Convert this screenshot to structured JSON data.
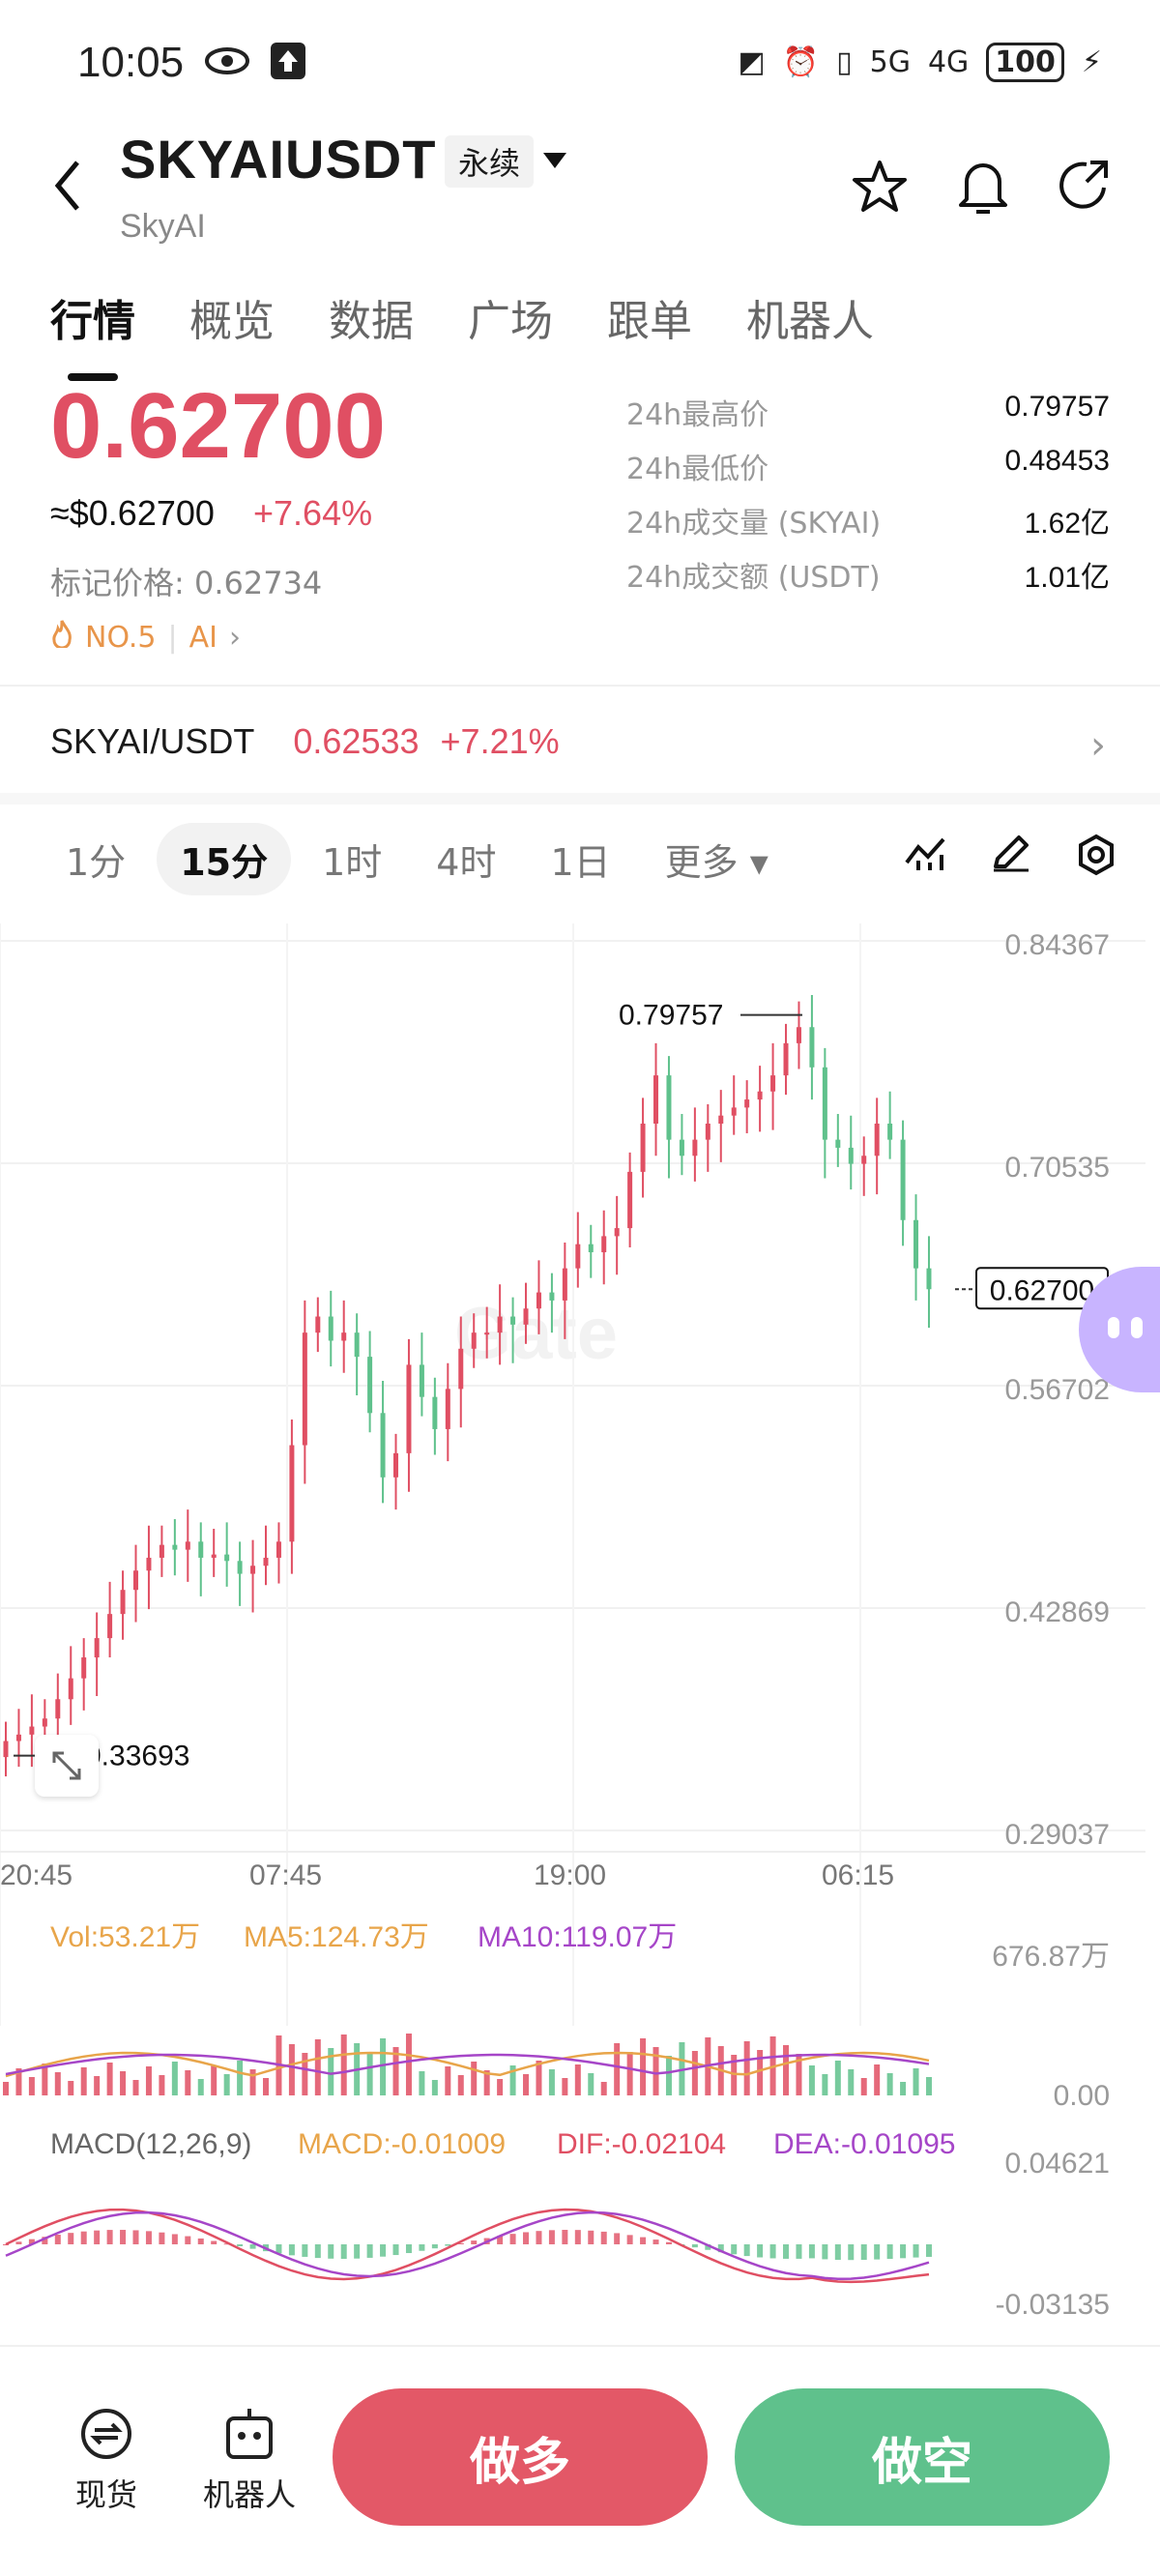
{
  "status": {
    "time": "10:05",
    "network1": "5G",
    "network2": "4G",
    "battery": "100"
  },
  "header": {
    "symbol": "SKYAIUSDT",
    "contract_type": "永续",
    "name": "SkyAI"
  },
  "tabs": [
    "行情",
    "概览",
    "数据",
    "广场",
    "跟单",
    "机器人"
  ],
  "price": {
    "last": "0.62700",
    "usd": "≈$0.62700",
    "change": "+7.64%",
    "mark_label": "标记价格: 0.62734",
    "rank": "NO.5",
    "category": "AI"
  },
  "stats": [
    {
      "label": "24h最高价",
      "value": "0.79757"
    },
    {
      "label": "24h最低价",
      "value": "0.48453"
    },
    {
      "label": "24h成交量 (SKYAI)",
      "value": "1.62亿"
    },
    {
      "label": "24h成交额 (USDT)",
      "value": "1.01亿"
    }
  ],
  "spot": {
    "pair": "SKYAI/USDT",
    "price": "0.62533",
    "change": "+7.21%"
  },
  "timeframes": [
    "1分",
    "15分",
    "1时",
    "4时",
    "1日",
    "更多"
  ],
  "timeframe_selected": "15分",
  "chart_data": {
    "type": "candlestick",
    "y_ticks": [
      "0.84367",
      "0.70535",
      "0.56702",
      "0.42869",
      "0.29037"
    ],
    "ylim": [
      0.29037,
      0.84367
    ],
    "x_ticks": [
      "20:45",
      "07:45",
      "19:00",
      "06:15"
    ],
    "high_label": "0.79757",
    "low_label": "0.33693",
    "last_label": "0.62700",
    "watermark": "Gate",
    "closes": [
      0.346,
      0.35,
      0.355,
      0.36,
      0.372,
      0.385,
      0.398,
      0.41,
      0.425,
      0.44,
      0.452,
      0.46,
      0.468,
      0.465,
      0.47,
      0.46,
      0.462,
      0.458,
      0.45,
      0.455,
      0.46,
      0.47,
      0.53,
      0.6,
      0.61,
      0.595,
      0.6,
      0.585,
      0.55,
      0.51,
      0.525,
      0.58,
      0.56,
      0.54,
      0.565,
      0.59,
      0.6,
      0.6,
      0.61,
      0.605,
      0.615,
      0.625,
      0.62,
      0.64,
      0.655,
      0.65,
      0.66,
      0.665,
      0.7,
      0.73,
      0.76,
      0.72,
      0.71,
      0.72,
      0.73,
      0.735,
      0.74,
      0.745,
      0.75,
      0.76,
      0.78,
      0.79,
      0.765,
      0.72,
      0.715,
      0.705,
      0.71,
      0.73,
      0.72,
      0.67,
      0.64,
      0.627
    ],
    "volume": {
      "vol": "Vol:53.21万",
      "ma5": "MA5:124.73万",
      "ma10": "MA10:119.07万",
      "max": "676.87万",
      "min": "0.00"
    },
    "macd": {
      "label": "MACD(12,26,9)",
      "macd": "MACD:-0.01009",
      "dif": "DIF:-0.02104",
      "dea": "DEA:-0.01095",
      "max": "0.04621",
      "min": "-0.03135"
    }
  },
  "bottom": {
    "spot_label": "现货",
    "bot_label": "机器人",
    "long": "做多",
    "short": "做空"
  },
  "colors": {
    "up": "#e04f63",
    "down": "#5fc18c",
    "ma5": "#e8a54a",
    "ma10": "#a646c8"
  }
}
